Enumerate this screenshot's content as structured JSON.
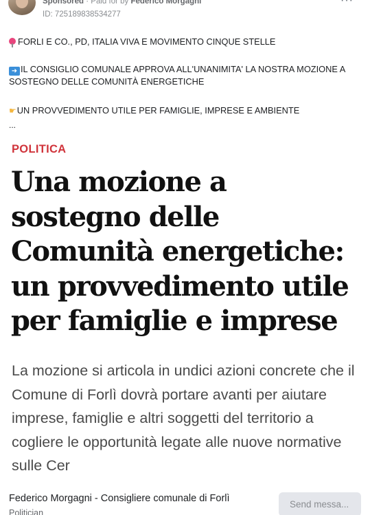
{
  "header": {
    "sponsored_label": "Sponsored",
    "separator": " · ",
    "paid_for_by_prefix": "Paid for by ",
    "paid_for_by_name": "Federico Morgagni",
    "ad_id": "ID: 725189838534277",
    "more_label": "···"
  },
  "caption": {
    "line1": "FORLI E CO., PD, ITALIA VIVA E MOVIMENTO CINQUE STELLE",
    "line2": "IL CONSIGLIO COMUNALE APPROVA ALL'UNANIMITA' LA NOSTRA MOZIONE A SOSTEGNO DELLE COMUNITÀ ENERGETICHE",
    "line3": "UN PROVVEDIMENTO UTILE PER FAMIGLIE, IMPRESE E AMBIENTE",
    "see_more": "..."
  },
  "article": {
    "kicker": "POLITICA",
    "headline": "Una mozione a sostegno delle Comunità energetiche: un provvedimento utile per famiglie e imprese",
    "summary": "La mozione si articola in undici azioni concrete che il Comune di Forlì dovrà portare avanti per aiutare imprese, famiglie e altri soggetti del territorio a cogliere le opportunità legate alle nuove normative sulle Cer",
    "kicker_color": "#d0343b"
  },
  "footer": {
    "page_name": "Federico Morgagni - Consigliere comunale di Forlì",
    "page_category": "Politician",
    "send_button_label": "Send messa..."
  },
  "icons": {
    "pin": "round-pushpin-icon",
    "arrow": "right-arrow-icon",
    "hand": "pointing-hand-icon"
  }
}
